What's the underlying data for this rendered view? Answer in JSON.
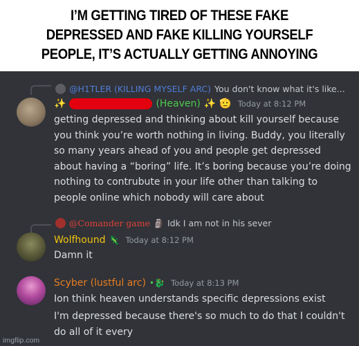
{
  "caption": {
    "lines": [
      "I’M GETTING TIRED OF THESE FAKE",
      "DEPRESSED AND FAKE KILLING YOURSELF",
      "PEOPLE, IT’S ACTUALLY GETTING ANNOYING"
    ]
  },
  "messages": [
    {
      "reply": {
        "name": "@H1TLER (KILLING MYSELF ARC)",
        "text": "You don't know what it's like...",
        "name_color": "#4f7dd6"
      },
      "username_suffix": "(Heaven)",
      "username_color": "#4ec94e",
      "sparkle": "✨",
      "emoji": "🫡",
      "timestamp": "Today at 8:12 PM",
      "body": "getting depressed and thinking about kill yourself because you think you’re worth nothing in living. Buddy, you literally so many years ahead of you and people get depressed about having a “boring” life. It’s boring because you’re doing nothing to contrubute in your life other than talking to people online which nobody will care about"
    },
    {
      "reply": {
        "name": "@Comander game",
        "text": "Idk I am not in his sever",
        "name_color": "#e0413a",
        "badge": "🗿"
      },
      "username": "Wolfhound",
      "username_color": "#f1c40f",
      "badge": "🦎",
      "timestamp": "Today at 8:12 PM",
      "body": "Damn it"
    },
    {
      "username": "Scyber (lustful arc)",
      "username_color": "#e67e22",
      "badge": "•🐉",
      "timestamp": "Today at 8:13 PM",
      "body": "Ion think heaven understands specific depressions exist",
      "body2": "I'm depressed because there's so much to do that I couldn't do all of it every"
    }
  ],
  "watermark": "imgflip.com"
}
